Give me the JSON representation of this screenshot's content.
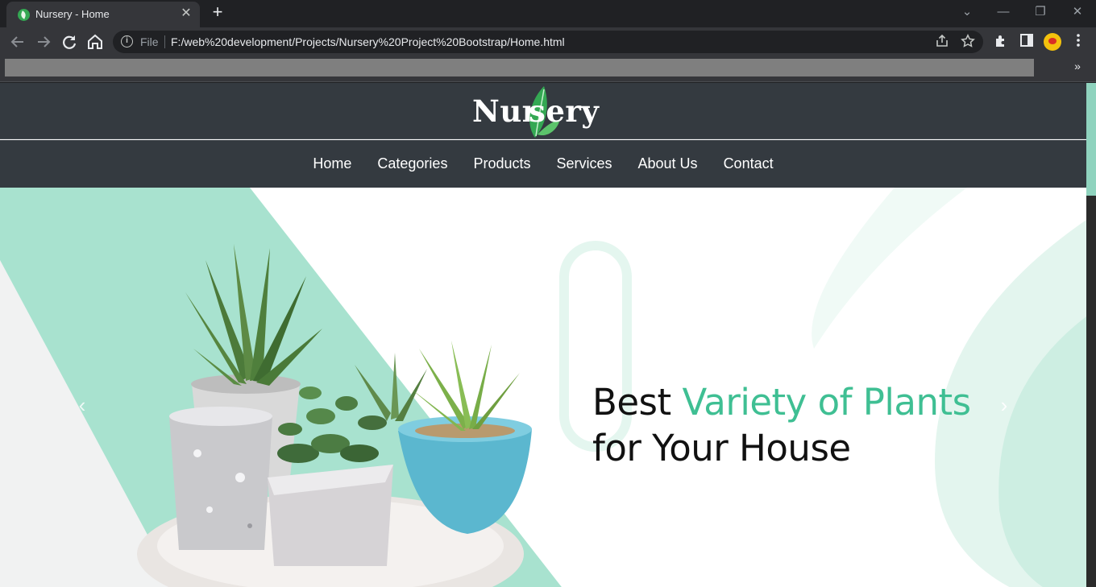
{
  "browser": {
    "tab_title": "Nursery - Home",
    "tab_close_glyph": "✕",
    "new_tab_glyph": "+",
    "scheme_label": "File",
    "url": "F:/web%20development/Projects/Nursery%20Project%20Bootstrap/Home.html",
    "bookmarks_more_glyph": "»",
    "window_controls": {
      "minimize": "—",
      "restore": "❐",
      "close": "✕",
      "tab_search": "⌄"
    }
  },
  "site": {
    "logo_text_left": "Nur",
    "logo_text_right": "sery",
    "nav": [
      {
        "label": "Home"
      },
      {
        "label": "Categories"
      },
      {
        "label": "Products"
      },
      {
        "label": "Services"
      },
      {
        "label": "About Us"
      },
      {
        "label": "Contact"
      }
    ]
  },
  "hero": {
    "headline_line1_plain": "Best ",
    "headline_line1_accent": "Variety of Plants",
    "headline_line2": "for Your House",
    "prev_glyph": "‹",
    "next_glyph": "›"
  },
  "colors": {
    "accent": "#3fbf93",
    "header_bg": "#343a40",
    "mint": "#a8e2cf",
    "leaf_green": "#34a853"
  },
  "icons": [
    "back-arrow-icon",
    "forward-arrow-icon",
    "reload-icon",
    "home-icon",
    "info-icon",
    "share-icon",
    "star-icon",
    "extensions-icon",
    "sidepanel-icon",
    "profile-avatar",
    "menu-kebab-icon",
    "leaf-logo-icon"
  ]
}
